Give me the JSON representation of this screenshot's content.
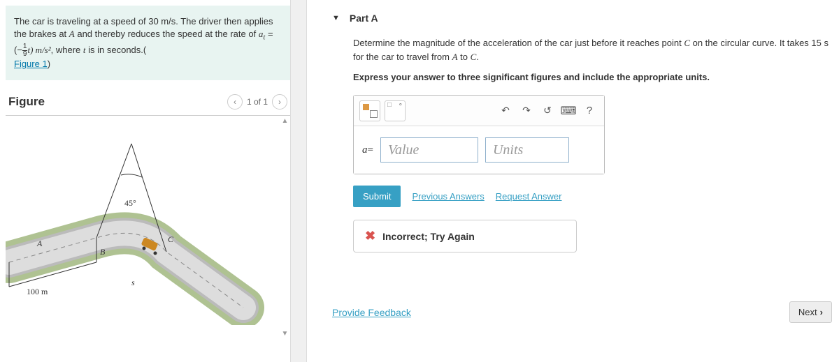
{
  "problem": {
    "text_pre": "The car is traveling at a speed of 30 ",
    "unit1": "m/s",
    "text_mid1": ". The driver then applies the brakes at ",
    "pointA": "A",
    "text_mid2": " and thereby reduces the speed at the rate of ",
    "eq_lhs": "a",
    "eq_sub": "t",
    "eq_eq": " = (−",
    "eq_frac_num": "1",
    "eq_frac_den": "9",
    "eq_rhs": "t) m/s²",
    "text_mid3": ", where ",
    "var_t": "t",
    "text_mid4": " is in seconds.(",
    "figure_link": "Figure 1",
    "text_end": ")"
  },
  "figure": {
    "title": "Figure",
    "counter": "1 of 1",
    "angle_label": "45°",
    "dist_label": "100 m",
    "ptA": "A",
    "ptB": "B",
    "ptC": "C",
    "ptS": "s"
  },
  "part": {
    "label": "Part A",
    "q_pre": "Determine the magnitude of the acceleration of the car just before it reaches point ",
    "q_ptC": "C",
    "q_mid": " on the circular curve. It takes 15 s for the car to travel from ",
    "q_ptA": "A",
    "q_to": " to ",
    "q_ptC2": "C",
    "q_end": ".",
    "instruction": "Express your answer to three significant figures and include the appropriate units."
  },
  "answer": {
    "var": "a",
    "equals": " =",
    "value_placeholder": "Value",
    "units_placeholder": "Units",
    "help": "?"
  },
  "actions": {
    "submit": "Submit",
    "previous": "Previous Answers",
    "request": "Request Answer"
  },
  "feedback": {
    "text": "Incorrect; Try Again"
  },
  "footer": {
    "provide": "Provide Feedback",
    "next": "Next"
  }
}
